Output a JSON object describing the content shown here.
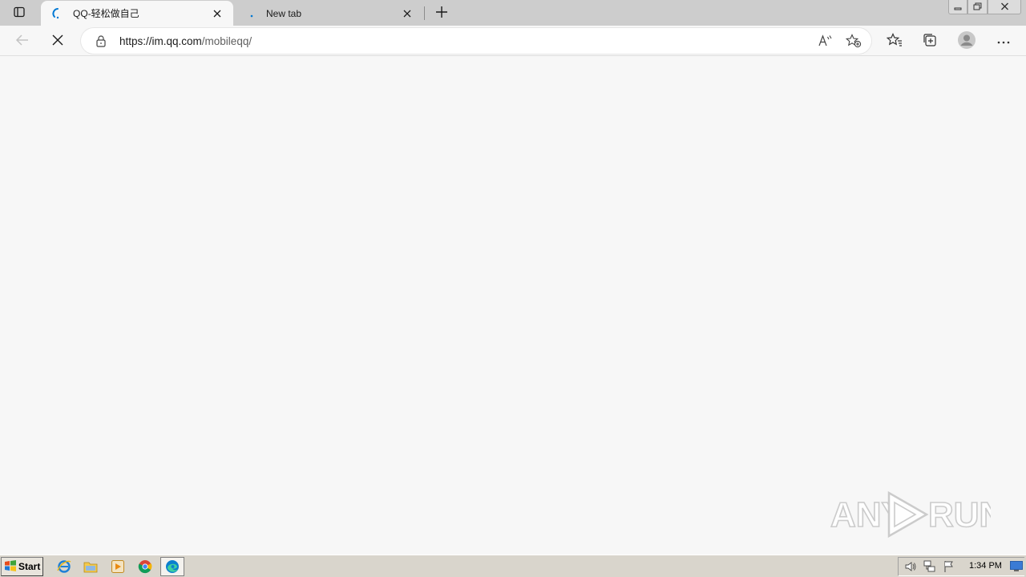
{
  "browser": {
    "tabs": [
      {
        "title": "QQ-轻松做自己",
        "active": true,
        "loading": true
      },
      {
        "title": "New tab",
        "active": false
      }
    ],
    "address": {
      "url_host": "https://im.qq.com",
      "url_path": "/mobileqq/"
    },
    "accent_color": "#0078d4"
  },
  "watermark": {
    "text_left": "ANY",
    "text_right": "RUN"
  },
  "taskbar": {
    "start_label": "Start",
    "apps": [
      "internet-explorer-icon",
      "file-explorer-icon",
      "media-player-icon",
      "chrome-icon",
      "edge-icon"
    ],
    "clock": "1:34 PM"
  }
}
